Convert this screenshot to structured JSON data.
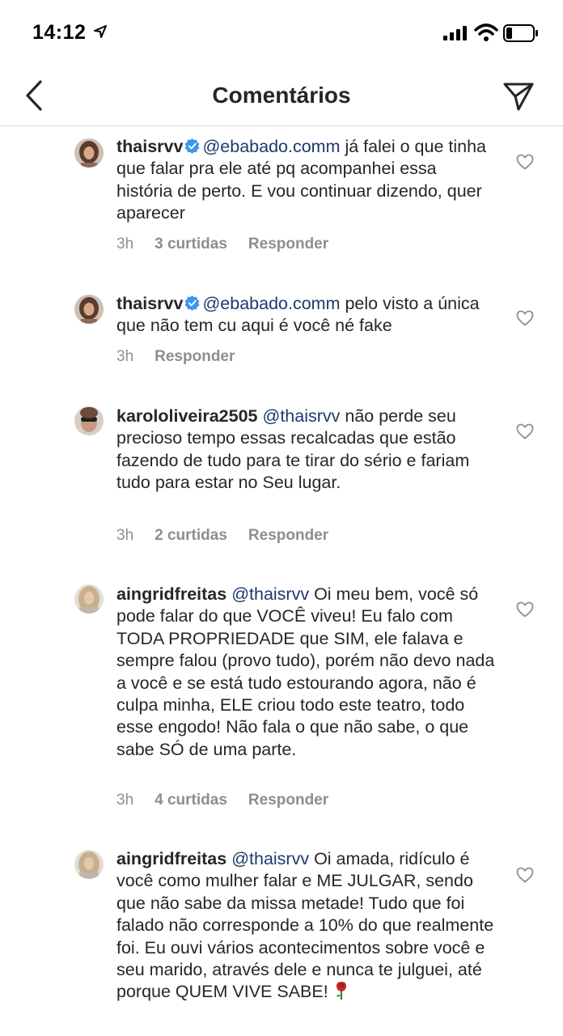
{
  "status_bar": {
    "time": "14:12"
  },
  "nav": {
    "title": "Comentários"
  },
  "comments": [
    {
      "username": "thaisrvv",
      "verified": true,
      "mention": "@ebabado.comm",
      "text": " já falei o que tinha que falar pra ele até pq acompanhei essa história de perto. E vou continuar dizendo, quer aparecer",
      "time": "3h",
      "likes": "3 curtidas",
      "reply": "Responder"
    },
    {
      "username": "thaisrvv",
      "verified": true,
      "mention": "@ebabado.comm",
      "text": " pelo visto a única que não tem cu aqui é você né fake",
      "time": "3h",
      "likes": "",
      "reply": "Responder"
    },
    {
      "username": "karololiveira2505",
      "verified": false,
      "mention": "@thaisrvv",
      "text": " não perde seu precioso tempo essas recalcadas que estão fazendo de tudo para te tirar do sério e fariam tudo para estar no Seu lugar.",
      "time": "3h",
      "likes": "2 curtidas",
      "reply": "Responder"
    },
    {
      "username": "aingridfreitas",
      "verified": false,
      "mention": "@thaisrvv",
      "text": " Oi meu bem, você só pode falar do que VOCÊ viveu! Eu falo com TODA PROPRIEDADE que SIM, ele falava e sempre falou (provo tudo), porém não devo nada a você e se está tudo estourando agora, não é culpa minha, ELE criou todo este teatro, todo esse engodo! Não fala o que não sabe, o que sabe SÓ de uma parte.",
      "time": "3h",
      "likes": "4 curtidas",
      "reply": "Responder"
    },
    {
      "username": "aingridfreitas",
      "verified": false,
      "mention": "@thaisrvv",
      "text": " Oi amada, ridículo é você como mulher falar e ME JULGAR, sendo que não sabe da missa metade! Tudo que foi falado não corresponde a 10% do que realmente foi. Eu ouvi vários acontecimentos sobre você e seu marido, através dele e nunca te julguei, até porque QUEM VIVE SABE!",
      "emoji": "rose-emoji",
      "time": "",
      "likes": "",
      "reply": ""
    }
  ],
  "colors": {
    "mention": "#1b3a6b",
    "meta": "#8e8e8e",
    "verified": "#3897f0",
    "divider": "#dbdbdb"
  }
}
